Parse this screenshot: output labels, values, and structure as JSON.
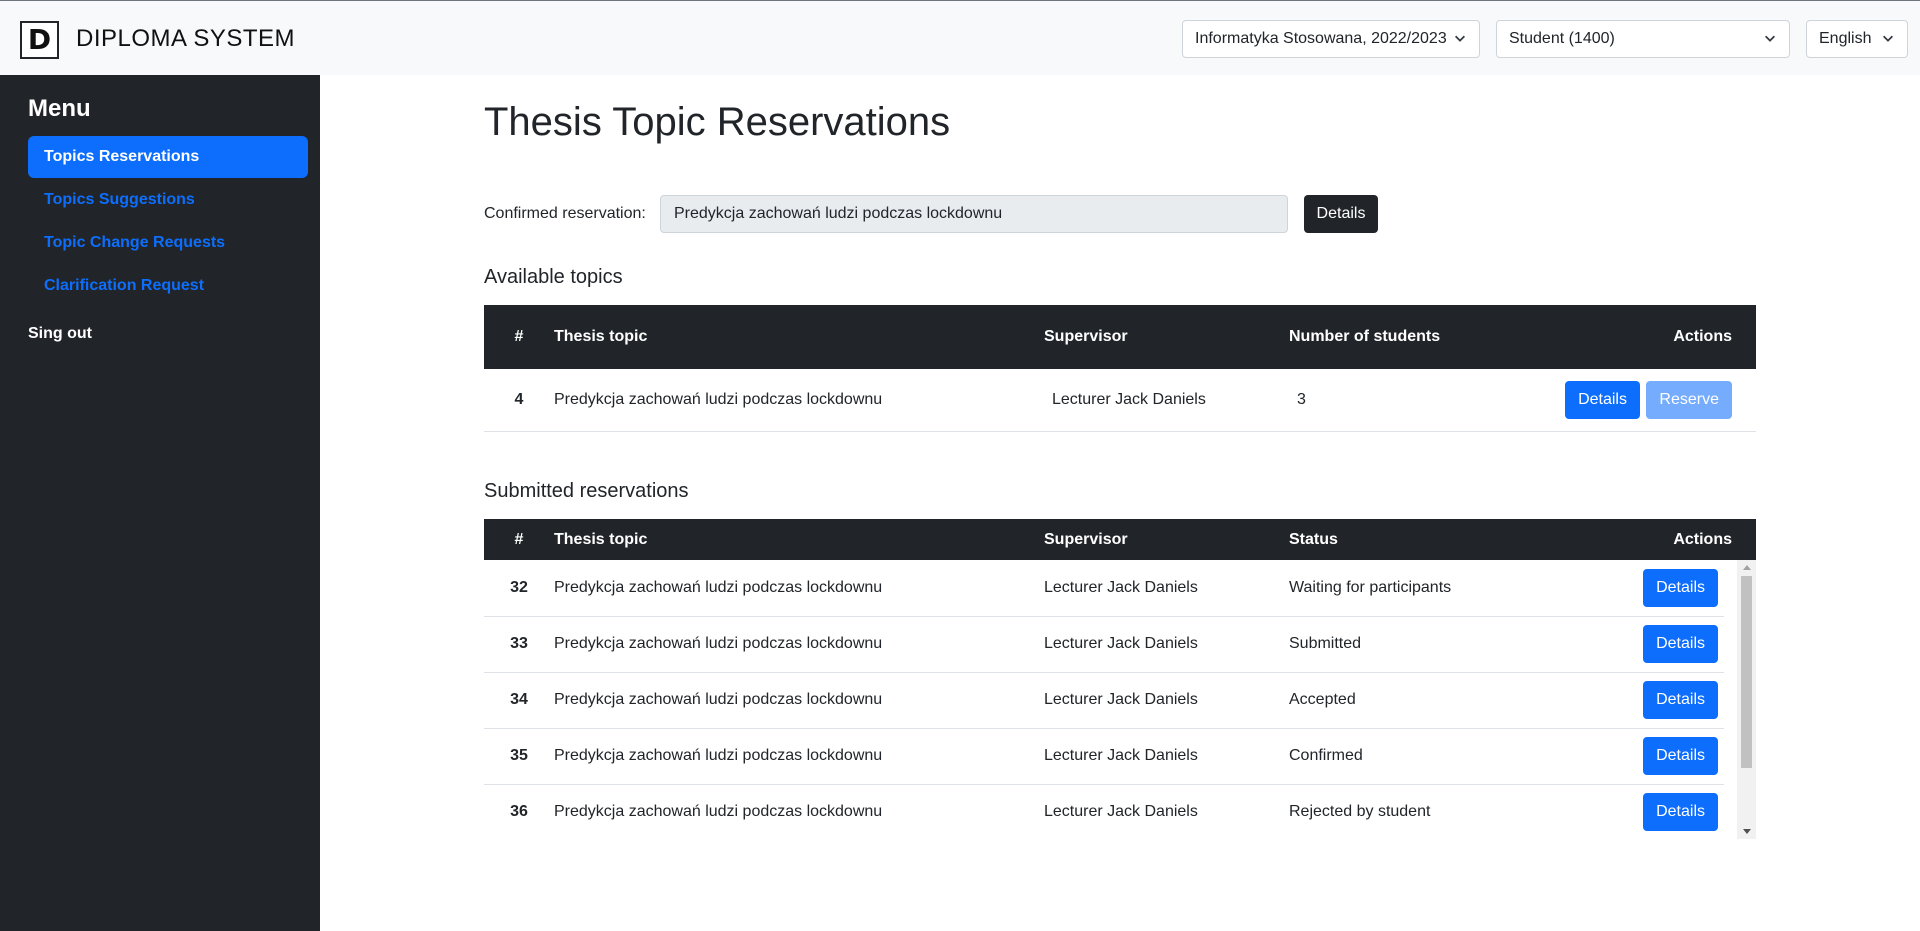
{
  "header": {
    "logo_letter": "D",
    "brand": "DIPLOMA SYSTEM",
    "program_select": "Informatyka Stosowana, 2022/2023",
    "role_select": "Student (1400)",
    "language_select": "English"
  },
  "sidebar": {
    "title": "Menu",
    "items": [
      {
        "label": "Topics Reservations",
        "active": true
      },
      {
        "label": "Topics Suggestions",
        "active": false
      },
      {
        "label": "Topic Change Requests",
        "active": false
      },
      {
        "label": "Clarification Request",
        "active": false
      }
    ],
    "signout": "Sing out"
  },
  "main": {
    "title": "Thesis Topic Reservations",
    "confirmed_label": "Confirmed reservation:",
    "confirmed_value": "Predykcja zachowań ludzi podczas lockdownu",
    "details_label": "Details",
    "available": {
      "heading": "Available topics",
      "columns": [
        "#",
        "Thesis topic",
        "Supervisor",
        "Number of students",
        "Actions"
      ],
      "rows": [
        {
          "id": "4",
          "topic": "Predykcja zachowań ludzi podczas lockdownu",
          "supervisor": "Lecturer Jack Daniels",
          "students": "3",
          "details": "Details",
          "reserve": "Reserve"
        }
      ]
    },
    "submitted": {
      "heading": "Submitted reservations",
      "columns": [
        "#",
        "Thesis topic",
        "Supervisor",
        "Status",
        "Actions"
      ],
      "rows": [
        {
          "id": "32",
          "topic": "Predykcja zachowań ludzi podczas lockdownu",
          "supervisor": "Lecturer Jack Daniels",
          "status": "Waiting for participants",
          "details": "Details"
        },
        {
          "id": "33",
          "topic": "Predykcja zachowań ludzi podczas lockdownu",
          "supervisor": "Lecturer Jack Daniels",
          "status": "Submitted",
          "details": "Details"
        },
        {
          "id": "34",
          "topic": "Predykcja zachowań ludzi podczas lockdownu",
          "supervisor": "Lecturer Jack Daniels",
          "status": "Accepted",
          "details": "Details"
        },
        {
          "id": "35",
          "topic": "Predykcja zachowań ludzi podczas lockdownu",
          "supervisor": "Lecturer Jack Daniels",
          "status": "Confirmed",
          "details": "Details"
        },
        {
          "id": "36",
          "topic": "Predykcja zachowań ludzi podczas lockdownu",
          "supervisor": "Lecturer Jack Daniels",
          "status": "Rejected by student",
          "details": "Details"
        }
      ]
    }
  },
  "colors": {
    "primary": "#0d6efd",
    "dark": "#212529",
    "primary_disabled": "#6ea8fe",
    "input_bg": "#e9ecef"
  }
}
